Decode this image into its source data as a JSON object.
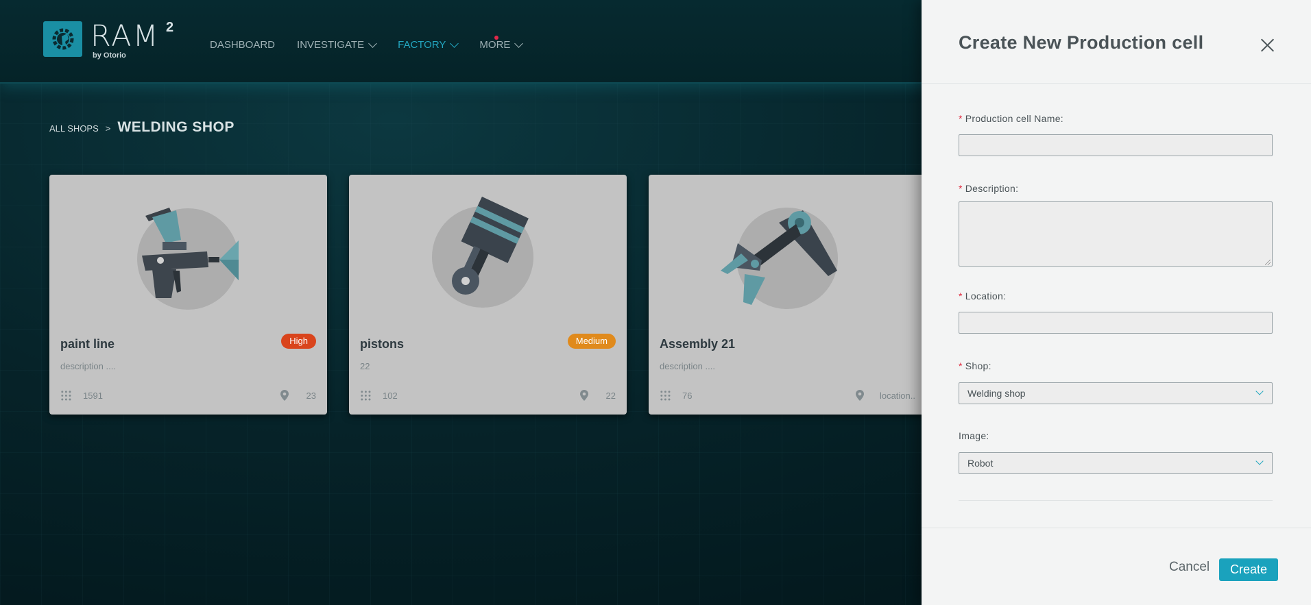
{
  "app": {
    "logo_title": "RAM",
    "logo_sup": "2",
    "logo_sub": "by Otorio"
  },
  "nav": {
    "items": [
      {
        "label": "DASHBOARD",
        "active": false,
        "has_menu": false
      },
      {
        "label": "INVESTIGATE",
        "active": false,
        "has_menu": true
      },
      {
        "label": "FACTORY",
        "active": true,
        "has_menu": true
      },
      {
        "label": "MORE",
        "active": false,
        "has_menu": true,
        "notification": true
      }
    ]
  },
  "breadcrumb": {
    "parent": "ALL SHOPS",
    "separator": ">",
    "current": "WELDING SHOP"
  },
  "cards": [
    {
      "title": "paint line",
      "badge": "High",
      "badge_color": "#d9441c",
      "description": "description ....",
      "count": "1591",
      "location": "23",
      "image": "spray-gun-icon"
    },
    {
      "title": "pistons",
      "badge": "Medium",
      "badge_color": "#e08a1c",
      "description": "22",
      "count": "102",
      "location": "22",
      "image": "piston-icon"
    },
    {
      "title": "Assembly 21",
      "badge": "",
      "badge_color": "",
      "description": "description ....",
      "count": "76",
      "location": "location..",
      "image": "robot-arm-icon"
    }
  ],
  "drawer": {
    "title": "Create New Production cell",
    "fields": {
      "name": {
        "label": "Production cell Name:",
        "required": true,
        "value": ""
      },
      "description": {
        "label": "Description:",
        "required": true,
        "value": ""
      },
      "location": {
        "label": "Location:",
        "required": true,
        "value": ""
      },
      "shop": {
        "label": "Shop:",
        "required": true,
        "value": "Welding shop"
      },
      "image": {
        "label": "Image:",
        "required": false,
        "value": "Robot"
      }
    },
    "required_mark": "*",
    "cancel_label": "Cancel",
    "create_label": "Create"
  },
  "colors": {
    "accent": "#1aa2bd",
    "nav_active": "#23a6c0",
    "required": "#e0283c"
  }
}
